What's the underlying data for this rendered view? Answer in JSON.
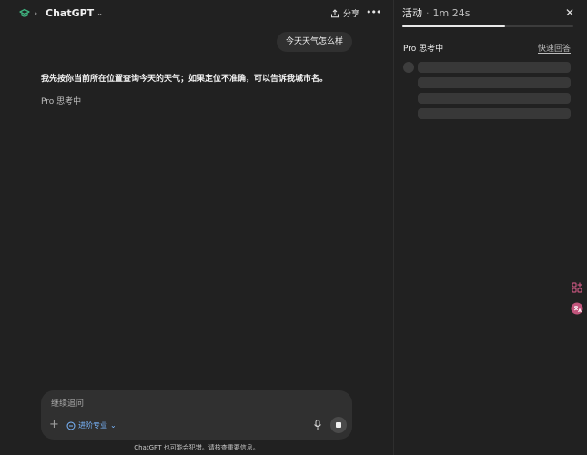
{
  "header": {
    "model_name": "ChatGPT",
    "share_label": "分享"
  },
  "conversation": {
    "user_message": "今天天气怎么样",
    "assistant_message": "我先按你当前所在位置查询今天的天气；如果定位不准确，可以告诉我城市名。",
    "status_label": "Pro 思考中"
  },
  "composer": {
    "placeholder": "继续追问",
    "mode_label": "进阶专业"
  },
  "disclaimer": "ChatGPT 也可能会犯错。请核查重要信息。",
  "activity_panel": {
    "title": "活动",
    "elapsed": "1m 24s",
    "progress": 0.6,
    "heading": "Pro 思考中",
    "quick_answer_label": "快速回答"
  },
  "colors": {
    "background": "#212121",
    "surface": "#303030",
    "accent_blue": "#7ab7ff",
    "logo_green": "#3fb37f",
    "side_tool_pink": "#c2557c"
  },
  "icons": [
    "openai-logo-icon",
    "chevron-right-icon",
    "chevron-down-icon",
    "share-icon",
    "more-icon",
    "close-icon",
    "plus-icon",
    "mode-icon",
    "mic-icon",
    "stop-icon",
    "extensions-icon",
    "translate-icon"
  ]
}
